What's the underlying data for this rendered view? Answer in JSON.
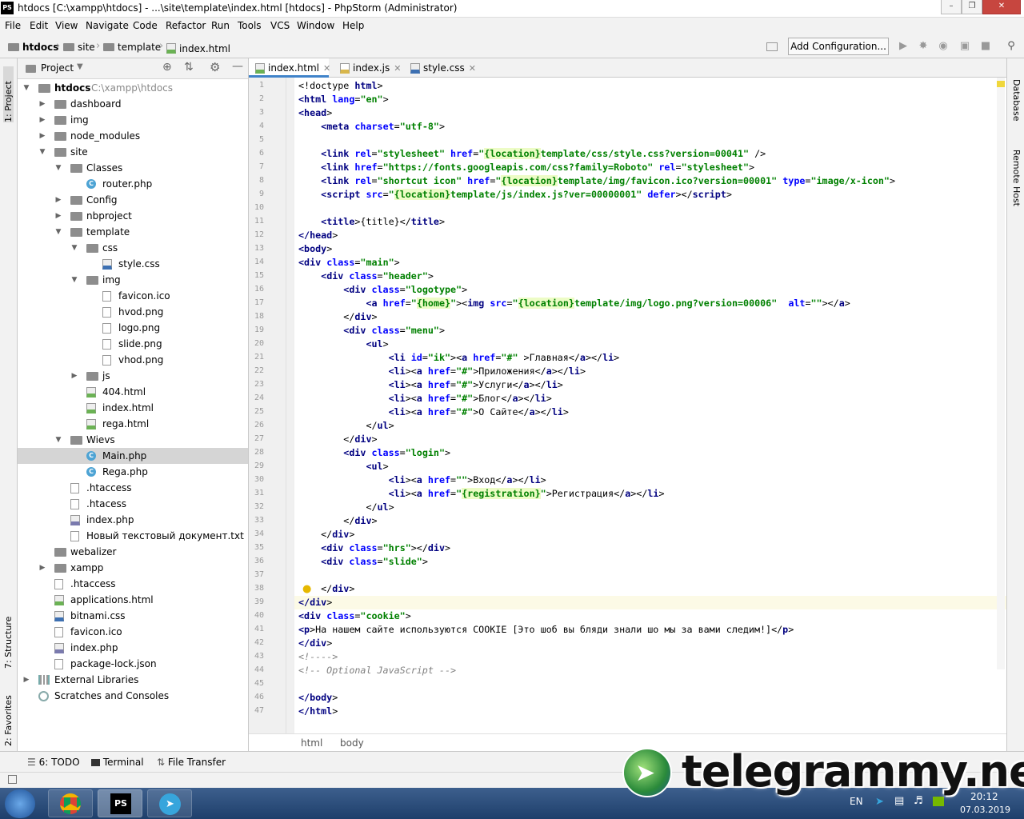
{
  "window": {
    "title": "htdocs [C:\\xampp\\htdocs] - ...\\site\\template\\index.html [htdocs] - PhpStorm (Administrator)",
    "logo": "PS"
  },
  "menu": [
    "File",
    "Edit",
    "View",
    "Navigate",
    "Code",
    "Refactor",
    "Run",
    "Tools",
    "VCS",
    "Window",
    "Help"
  ],
  "breadcrumbs": [
    "htdocs",
    "site",
    "template",
    "index.html"
  ],
  "toolbar": {
    "add_configuration": "Add Configuration..."
  },
  "left_tabs": {
    "project": "1: Project",
    "structure": "7: Structure",
    "favorites": "2: Favorites"
  },
  "right_tabs": {
    "database": "Database",
    "remote_host": "Remote Host"
  },
  "project_panel": {
    "title": "Project",
    "tree": [
      {
        "label": "htdocs",
        "path": "C:\\xampp\\htdocs",
        "icon": "folder",
        "expanded": true
      },
      {
        "label": "dashboard",
        "icon": "folder"
      },
      {
        "label": "img",
        "icon": "folder"
      },
      {
        "label": "node_modules",
        "icon": "folder"
      },
      {
        "label": "site",
        "icon": "folder",
        "expanded": true
      },
      {
        "label": "Classes",
        "icon": "folder",
        "expanded": true
      },
      {
        "label": "router.php",
        "icon": "class"
      },
      {
        "label": "Config",
        "icon": "folder"
      },
      {
        "label": "nbproject",
        "icon": "folder"
      },
      {
        "label": "template",
        "icon": "folder",
        "expanded": true
      },
      {
        "label": "css",
        "icon": "folder",
        "expanded": true
      },
      {
        "label": "style.css",
        "icon": "css"
      },
      {
        "label": "img",
        "icon": "folder",
        "expanded": true
      },
      {
        "label": "favicon.ico",
        "icon": "file"
      },
      {
        "label": "hvod.png",
        "icon": "file"
      },
      {
        "label": "logo.png",
        "icon": "file"
      },
      {
        "label": "slide.png",
        "icon": "file"
      },
      {
        "label": "vhod.png",
        "icon": "file"
      },
      {
        "label": "js",
        "icon": "folder"
      },
      {
        "label": "404.html",
        "icon": "html"
      },
      {
        "label": "index.html",
        "icon": "html"
      },
      {
        "label": "rega.html",
        "icon": "html"
      },
      {
        "label": "Wievs",
        "icon": "folder",
        "expanded": true
      },
      {
        "label": "Main.php",
        "icon": "class",
        "selected": true
      },
      {
        "label": "Rega.php",
        "icon": "class"
      },
      {
        "label": ".htaccess",
        "icon": "file"
      },
      {
        "label": ".htacess",
        "icon": "file"
      },
      {
        "label": "index.php",
        "icon": "php"
      },
      {
        "label": "Новый текстовый документ.txt",
        "icon": "file"
      },
      {
        "label": "webalizer",
        "icon": "folder"
      },
      {
        "label": "xampp",
        "icon": "folder"
      },
      {
        "label": ".htaccess",
        "icon": "file"
      },
      {
        "label": "applications.html",
        "icon": "html"
      },
      {
        "label": "bitnami.css",
        "icon": "css"
      },
      {
        "label": "favicon.ico",
        "icon": "file"
      },
      {
        "label": "index.php",
        "icon": "php"
      },
      {
        "label": "package-lock.json",
        "icon": "file"
      },
      {
        "label": "External Libraries",
        "icon": "lib"
      },
      {
        "label": "Scratches and Consoles",
        "icon": "scratch"
      }
    ]
  },
  "editor": {
    "tabs": [
      {
        "label": "index.html",
        "icon": "html",
        "active": true
      },
      {
        "label": "index.js",
        "icon": "js"
      },
      {
        "label": "style.css",
        "icon": "css"
      }
    ],
    "current_line": 39,
    "lines": [
      [
        [
          "p",
          "<!doctype "
        ],
        [
          "t",
          "html"
        ],
        [
          "p",
          ">"
        ]
      ],
      [
        [
          "t",
          "<html "
        ],
        [
          "a",
          "lang"
        ],
        [
          "p",
          "="
        ],
        [
          "v",
          "\"en\""
        ],
        [
          "p",
          ">"
        ]
      ],
      [
        [
          "t",
          "<head"
        ],
        [
          "p",
          ">"
        ]
      ],
      [
        [
          "p",
          "    "
        ],
        [
          "t",
          "<meta "
        ],
        [
          "a",
          "charset"
        ],
        [
          "p",
          "="
        ],
        [
          "v",
          "\"utf-8\""
        ],
        [
          "p",
          ">"
        ]
      ],
      [],
      [
        [
          "p",
          "    "
        ],
        [
          "t",
          "<link "
        ],
        [
          "a",
          "rel"
        ],
        [
          "p",
          "="
        ],
        [
          "v",
          "\"stylesheet\" "
        ],
        [
          "a",
          "href"
        ],
        [
          "p",
          "="
        ],
        [
          "v",
          "\""
        ],
        [
          "tp",
          "{location}"
        ],
        [
          "v",
          "template/css/style.css?version=00041\""
        ],
        [
          "p",
          " />"
        ]
      ],
      [
        [
          "p",
          "    "
        ],
        [
          "t",
          "<link "
        ],
        [
          "a",
          "href"
        ],
        [
          "p",
          "="
        ],
        [
          "v",
          "\"https://fonts.googleapis.com/css?family=Roboto\" "
        ],
        [
          "a",
          "rel"
        ],
        [
          "p",
          "="
        ],
        [
          "v",
          "\"stylesheet\""
        ],
        [
          "p",
          ">"
        ]
      ],
      [
        [
          "p",
          "    "
        ],
        [
          "t",
          "<link "
        ],
        [
          "a",
          "rel"
        ],
        [
          "p",
          "="
        ],
        [
          "v",
          "\"shortcut icon\" "
        ],
        [
          "a",
          "href"
        ],
        [
          "p",
          "="
        ],
        [
          "v",
          "\""
        ],
        [
          "tp",
          "{location}"
        ],
        [
          "v",
          "template/img/favicon.ico?version=00001\" "
        ],
        [
          "a",
          "type"
        ],
        [
          "p",
          "="
        ],
        [
          "v",
          "\"image/x-icon\""
        ],
        [
          "p",
          ">"
        ]
      ],
      [
        [
          "p",
          "    "
        ],
        [
          "t",
          "<script "
        ],
        [
          "a",
          "src"
        ],
        [
          "p",
          "="
        ],
        [
          "v",
          "\""
        ],
        [
          "tp",
          "{location}"
        ],
        [
          "v",
          "template/js/index.js?ver=00000001\" "
        ],
        [
          "a",
          "defer"
        ],
        [
          "p",
          "></"
        ],
        [
          "t",
          "script"
        ],
        [
          "p",
          ">"
        ]
      ],
      [],
      [
        [
          "p",
          "    "
        ],
        [
          "t",
          "<title"
        ],
        [
          "p",
          ">{title}</"
        ],
        [
          "t",
          "title"
        ],
        [
          "p",
          ">"
        ]
      ],
      [
        [
          "t",
          "</head"
        ],
        [
          "p",
          ">"
        ]
      ],
      [
        [
          "t",
          "<body"
        ],
        [
          "p",
          ">"
        ]
      ],
      [
        [
          "t",
          "<div "
        ],
        [
          "a",
          "class"
        ],
        [
          "p",
          "="
        ],
        [
          "v",
          "\"main\""
        ],
        [
          "p",
          ">"
        ]
      ],
      [
        [
          "p",
          "    "
        ],
        [
          "t",
          "<div "
        ],
        [
          "a",
          "class"
        ],
        [
          "p",
          "="
        ],
        [
          "v",
          "\"header\""
        ],
        [
          "p",
          ">"
        ]
      ],
      [
        [
          "p",
          "        "
        ],
        [
          "t",
          "<div "
        ],
        [
          "a",
          "class"
        ],
        [
          "p",
          "="
        ],
        [
          "v",
          "\"logotype\""
        ],
        [
          "p",
          ">"
        ]
      ],
      [
        [
          "p",
          "            "
        ],
        [
          "t",
          "<a "
        ],
        [
          "a",
          "href"
        ],
        [
          "p",
          "="
        ],
        [
          "v",
          "\""
        ],
        [
          "tp",
          "{home}"
        ],
        [
          "v",
          "\""
        ],
        [
          "p",
          "><"
        ],
        [
          "t",
          "img "
        ],
        [
          "a",
          "src"
        ],
        [
          "p",
          "="
        ],
        [
          "v",
          "\""
        ],
        [
          "tp",
          "{location}"
        ],
        [
          "v",
          "template/img/logo.png?version=00006\"  "
        ],
        [
          "a",
          "alt"
        ],
        [
          "p",
          "="
        ],
        [
          "v",
          "\"\""
        ],
        [
          "p",
          "></"
        ],
        [
          "t",
          "a"
        ],
        [
          "p",
          ">"
        ]
      ],
      [
        [
          "p",
          "        </"
        ],
        [
          "t",
          "div"
        ],
        [
          "p",
          ">"
        ]
      ],
      [
        [
          "p",
          "        "
        ],
        [
          "t",
          "<div "
        ],
        [
          "a",
          "class"
        ],
        [
          "p",
          "="
        ],
        [
          "v",
          "\"menu\""
        ],
        [
          "p",
          ">"
        ]
      ],
      [
        [
          "p",
          "            "
        ],
        [
          "t",
          "<ul"
        ],
        [
          "p",
          ">"
        ]
      ],
      [
        [
          "p",
          "                "
        ],
        [
          "t",
          "<li "
        ],
        [
          "a",
          "id"
        ],
        [
          "p",
          "="
        ],
        [
          "v",
          "\"ik\""
        ],
        [
          "p",
          "><"
        ],
        [
          "t",
          "a "
        ],
        [
          "a",
          "href"
        ],
        [
          "p",
          "="
        ],
        [
          "v",
          "\"#\" "
        ],
        [
          "p",
          ">Главная</"
        ],
        [
          "t",
          "a"
        ],
        [
          "p",
          "></"
        ],
        [
          "t",
          "li"
        ],
        [
          "p",
          ">"
        ]
      ],
      [
        [
          "p",
          "                "
        ],
        [
          "t",
          "<li"
        ],
        [
          "p",
          "><"
        ],
        [
          "t",
          "a "
        ],
        [
          "a",
          "href"
        ],
        [
          "p",
          "="
        ],
        [
          "v",
          "\"#\""
        ],
        [
          "p",
          ">Приложения</"
        ],
        [
          "t",
          "a"
        ],
        [
          "p",
          "></"
        ],
        [
          "t",
          "li"
        ],
        [
          "p",
          ">"
        ]
      ],
      [
        [
          "p",
          "                "
        ],
        [
          "t",
          "<li"
        ],
        [
          "p",
          "><"
        ],
        [
          "t",
          "a "
        ],
        [
          "a",
          "href"
        ],
        [
          "p",
          "="
        ],
        [
          "v",
          "\"#\""
        ],
        [
          "p",
          ">Услуги</"
        ],
        [
          "t",
          "a"
        ],
        [
          "p",
          "></"
        ],
        [
          "t",
          "li"
        ],
        [
          "p",
          ">"
        ]
      ],
      [
        [
          "p",
          "                "
        ],
        [
          "t",
          "<li"
        ],
        [
          "p",
          "><"
        ],
        [
          "t",
          "a "
        ],
        [
          "a",
          "href"
        ],
        [
          "p",
          "="
        ],
        [
          "v",
          "\"#\""
        ],
        [
          "p",
          ">Блог</"
        ],
        [
          "t",
          "a"
        ],
        [
          "p",
          "></"
        ],
        [
          "t",
          "li"
        ],
        [
          "p",
          ">"
        ]
      ],
      [
        [
          "p",
          "                "
        ],
        [
          "t",
          "<li"
        ],
        [
          "p",
          "><"
        ],
        [
          "t",
          "a "
        ],
        [
          "a",
          "href"
        ],
        [
          "p",
          "="
        ],
        [
          "v",
          "\"#\""
        ],
        [
          "p",
          ">О Сайте</"
        ],
        [
          "t",
          "a"
        ],
        [
          "p",
          "></"
        ],
        [
          "t",
          "li"
        ],
        [
          "p",
          ">"
        ]
      ],
      [
        [
          "p",
          "            </"
        ],
        [
          "t",
          "ul"
        ],
        [
          "p",
          ">"
        ]
      ],
      [
        [
          "p",
          "        </"
        ],
        [
          "t",
          "div"
        ],
        [
          "p",
          ">"
        ]
      ],
      [
        [
          "p",
          "        "
        ],
        [
          "t",
          "<div "
        ],
        [
          "a",
          "class"
        ],
        [
          "p",
          "="
        ],
        [
          "v",
          "\"login\""
        ],
        [
          "p",
          ">"
        ]
      ],
      [
        [
          "p",
          "            "
        ],
        [
          "t",
          "<ul"
        ],
        [
          "p",
          ">"
        ]
      ],
      [
        [
          "p",
          "                "
        ],
        [
          "t",
          "<li"
        ],
        [
          "p",
          "><"
        ],
        [
          "t",
          "a "
        ],
        [
          "a",
          "href"
        ],
        [
          "p",
          "="
        ],
        [
          "v",
          "\"\""
        ],
        [
          "p",
          ">Вход</"
        ],
        [
          "t",
          "a"
        ],
        [
          "p",
          "></"
        ],
        [
          "t",
          "li"
        ],
        [
          "p",
          ">"
        ]
      ],
      [
        [
          "p",
          "                "
        ],
        [
          "t",
          "<li"
        ],
        [
          "p",
          "><"
        ],
        [
          "t",
          "a "
        ],
        [
          "a",
          "href"
        ],
        [
          "p",
          "="
        ],
        [
          "v",
          "\""
        ],
        [
          "tp",
          "{registration}"
        ],
        [
          "v",
          "\""
        ],
        [
          "p",
          ">Регистрация</"
        ],
        [
          "t",
          "a"
        ],
        [
          "p",
          "></"
        ],
        [
          "t",
          "li"
        ],
        [
          "p",
          ">"
        ]
      ],
      [
        [
          "p",
          "            </"
        ],
        [
          "t",
          "ul"
        ],
        [
          "p",
          ">"
        ]
      ],
      [
        [
          "p",
          "        </"
        ],
        [
          "t",
          "div"
        ],
        [
          "p",
          ">"
        ]
      ],
      [
        [
          "p",
          "    </"
        ],
        [
          "t",
          "div"
        ],
        [
          "p",
          ">"
        ]
      ],
      [
        [
          "p",
          "    "
        ],
        [
          "t",
          "<div "
        ],
        [
          "a",
          "class"
        ],
        [
          "p",
          "="
        ],
        [
          "v",
          "\"hrs\""
        ],
        [
          "p",
          "></"
        ],
        [
          "t",
          "div"
        ],
        [
          "p",
          ">"
        ]
      ],
      [
        [
          "p",
          "    "
        ],
        [
          "t",
          "<div "
        ],
        [
          "a",
          "class"
        ],
        [
          "p",
          "="
        ],
        [
          "v",
          "\"slide\""
        ],
        [
          "p",
          ">"
        ]
      ],
      [],
      [
        [
          "p",
          "    </"
        ],
        [
          "t",
          "div"
        ],
        [
          "p",
          ">"
        ]
      ],
      [
        [
          "t",
          "</div"
        ],
        [
          "p",
          ">"
        ]
      ],
      [
        [
          "t",
          "<div "
        ],
        [
          "a",
          "class"
        ],
        [
          "p",
          "="
        ],
        [
          "v",
          "\"cookie\""
        ],
        [
          "p",
          ">"
        ]
      ],
      [
        [
          "t",
          "<p"
        ],
        [
          "p",
          ">На нашем сайте используются COOKIE [Это шоб вы бляди знали шо мы за вами следим!]</"
        ],
        [
          "t",
          "p"
        ],
        [
          "p",
          ">"
        ]
      ],
      [
        [
          "t",
          "</div"
        ],
        [
          "p",
          ">"
        ]
      ],
      [
        [
          "c",
          "<!---->"
        ]
      ],
      [
        [
          "c",
          "<!-- Optional JavaScript -->"
        ]
      ],
      [],
      [
        [
          "t",
          "</body"
        ],
        [
          "p",
          ">"
        ]
      ],
      [
        [
          "t",
          "</html"
        ],
        [
          "p",
          ">"
        ]
      ]
    ],
    "breadcrumb": [
      "html",
      "body"
    ]
  },
  "bottom_tools": {
    "todo": "6: TODO",
    "terminal": "Terminal",
    "file_transfer": "File Transfer"
  },
  "tray": {
    "lang": "EN",
    "time": "20:12",
    "date": "07.03.2019"
  },
  "watermark": "telegrammy.net"
}
